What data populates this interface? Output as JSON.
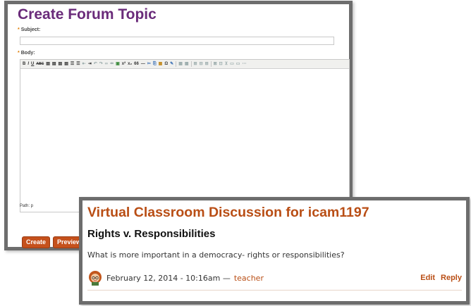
{
  "create_form": {
    "title": "Create Forum Topic",
    "subject_label": "Subject:",
    "subject_value": "",
    "body_label": "Body:",
    "required_marker": "*",
    "path_text": "Path: p",
    "buttons": {
      "create": "Create",
      "preview": "Preview"
    },
    "toolbar": {
      "bold": "B",
      "italic": "I",
      "underline": "U",
      "strike": "ABC",
      "superscript": "x²",
      "subscript": "x₂",
      "quote": "66",
      "dash": "—",
      "omega": "Ω"
    }
  },
  "discussion": {
    "title": "Virtual Classroom Discussion for icam1197",
    "subtitle": "Rights v. Responsibilities",
    "question": "What is more important in a democracy- rights or responsibilities?",
    "date": "February 12, 2014 - 10:16am —",
    "author": "teacher",
    "links": {
      "edit": "Edit",
      "reply": "Reply"
    }
  },
  "colors": {
    "create_title": "#6a2b7a",
    "accent_orange": "#b94e15",
    "button_bg": "#c5511c",
    "panel_border": "#6d6d6d"
  }
}
